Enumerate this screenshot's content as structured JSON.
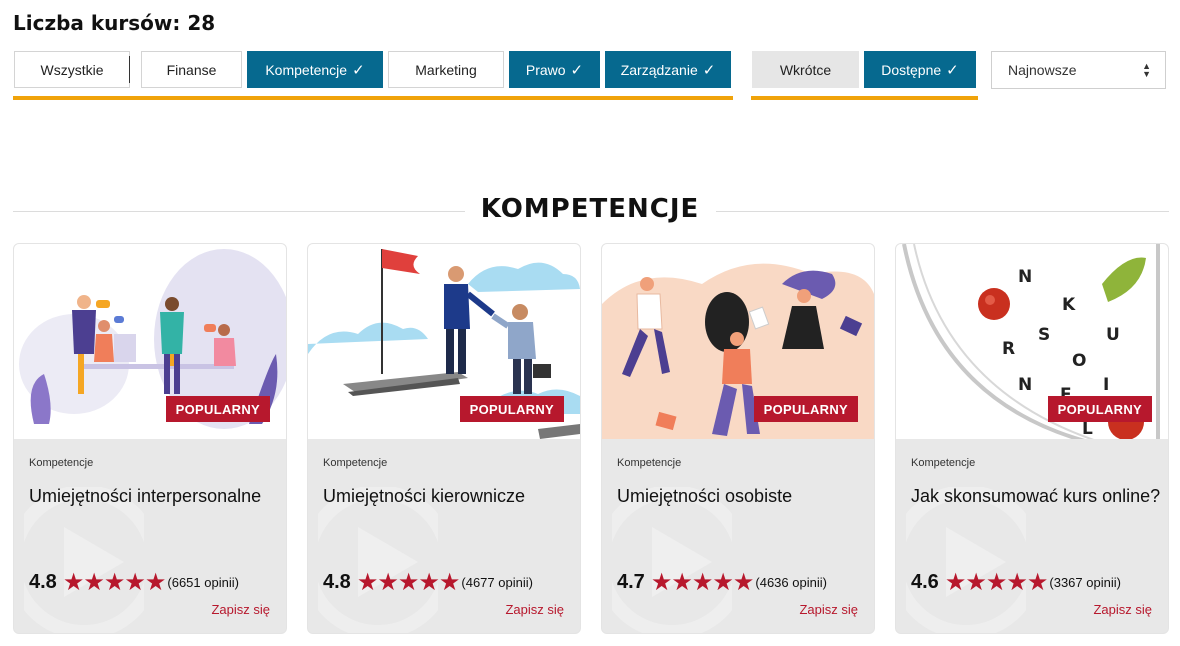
{
  "course_count": "Liczba kursów: 28",
  "category_filters": [
    {
      "label": "Wszystkie",
      "active": false
    },
    {
      "label": "Finanse",
      "active": false
    },
    {
      "label": "Kompetencje",
      "active": true
    },
    {
      "label": "Marketing",
      "active": false
    },
    {
      "label": "Prawo",
      "active": true
    },
    {
      "label": "Zarządzanie",
      "active": true
    }
  ],
  "availability_filters": [
    {
      "label": "Wkrótce",
      "active": false
    },
    {
      "label": "Dostępne",
      "active": true
    }
  ],
  "check_glyph": "✓",
  "sort": {
    "selected": "Najnowsze"
  },
  "section_title": "KOMPETENCJE",
  "badge_label": "POPULARNY",
  "enroll_label": "Zapisz się",
  "colors": {
    "accent": "#06698f",
    "underline": "#f0a30a",
    "badge": "#b7182d",
    "star": "#b7182d"
  },
  "courses": [
    {
      "category": "Kompetencje",
      "title": "Umiejętności interpersonalne",
      "rating": "4.8",
      "stars": "★★★★★",
      "reviews": "(6651 opinii)",
      "illustration": "team-at-desks-illustration"
    },
    {
      "category": "Kompetencje",
      "title": "Umiejętności kierownicze",
      "rating": "4.8",
      "stars": "★★★★★",
      "reviews": "(4677 opinii)",
      "illustration": "leader-helping-climb-illustration"
    },
    {
      "category": "Kompetencje",
      "title": "Umiejętności osobiste",
      "rating": "4.7",
      "stars": "★★★★★",
      "reviews": "(4636 opinii)",
      "illustration": "jumping-people-illustration"
    },
    {
      "category": "Kompetencje",
      "title": "Jak skonsumować kurs online?",
      "rating": "4.6",
      "stars": "★★★★★",
      "reviews": "(3367 opinii)",
      "illustration": "plate-with-letters-illustration"
    }
  ]
}
